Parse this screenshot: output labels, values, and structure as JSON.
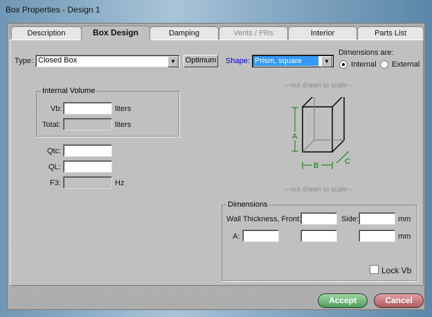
{
  "window": {
    "title": "Box Properties - Design 1"
  },
  "tabs": [
    {
      "label": "Description"
    },
    {
      "label": "Box Design"
    },
    {
      "label": "Damping"
    },
    {
      "label": "Vents / PRs"
    },
    {
      "label": "Interior"
    },
    {
      "label": "Parts List"
    }
  ],
  "type": {
    "label": "Type:",
    "value": "Closed Box",
    "optimum": "Optimum"
  },
  "shape": {
    "label": "Shape:",
    "value": "Prism, square"
  },
  "dims_are": {
    "label": "Dimensions are:",
    "internal": "Internal",
    "external": "External",
    "selected": "Internal"
  },
  "internal_volume": {
    "title": "Internal Volume",
    "vb_label": "Vb:",
    "vb_value": "",
    "vb_unit": "liters",
    "total_label": "Total:",
    "total_value": "",
    "total_unit": "liters"
  },
  "params": {
    "qtc_label": "Qtc:",
    "qtc_value": "",
    "ql_label": "QL:",
    "ql_value": "",
    "f3_label": "F3:",
    "f3_value": "",
    "f3_unit": "Hz"
  },
  "diagram": {
    "note_top": "---not drawn to scale---",
    "note_bottom": "---not drawn to scale---",
    "a": "A",
    "b": "B",
    "c": "C"
  },
  "dimensions": {
    "title": "Dimensions",
    "wall_label": "Wall Thickness, Front:",
    "front_value": "",
    "side_label": "Side:",
    "side_value": "",
    "unit1": "mm",
    "a_label": "A:",
    "a_value": "",
    "b_value": "",
    "c_value": "",
    "unit2": "mm",
    "lock_label": "Lock Vb",
    "lock_checked": false
  },
  "buttons": {
    "accept": "Accept",
    "cancel": "Cancel"
  }
}
